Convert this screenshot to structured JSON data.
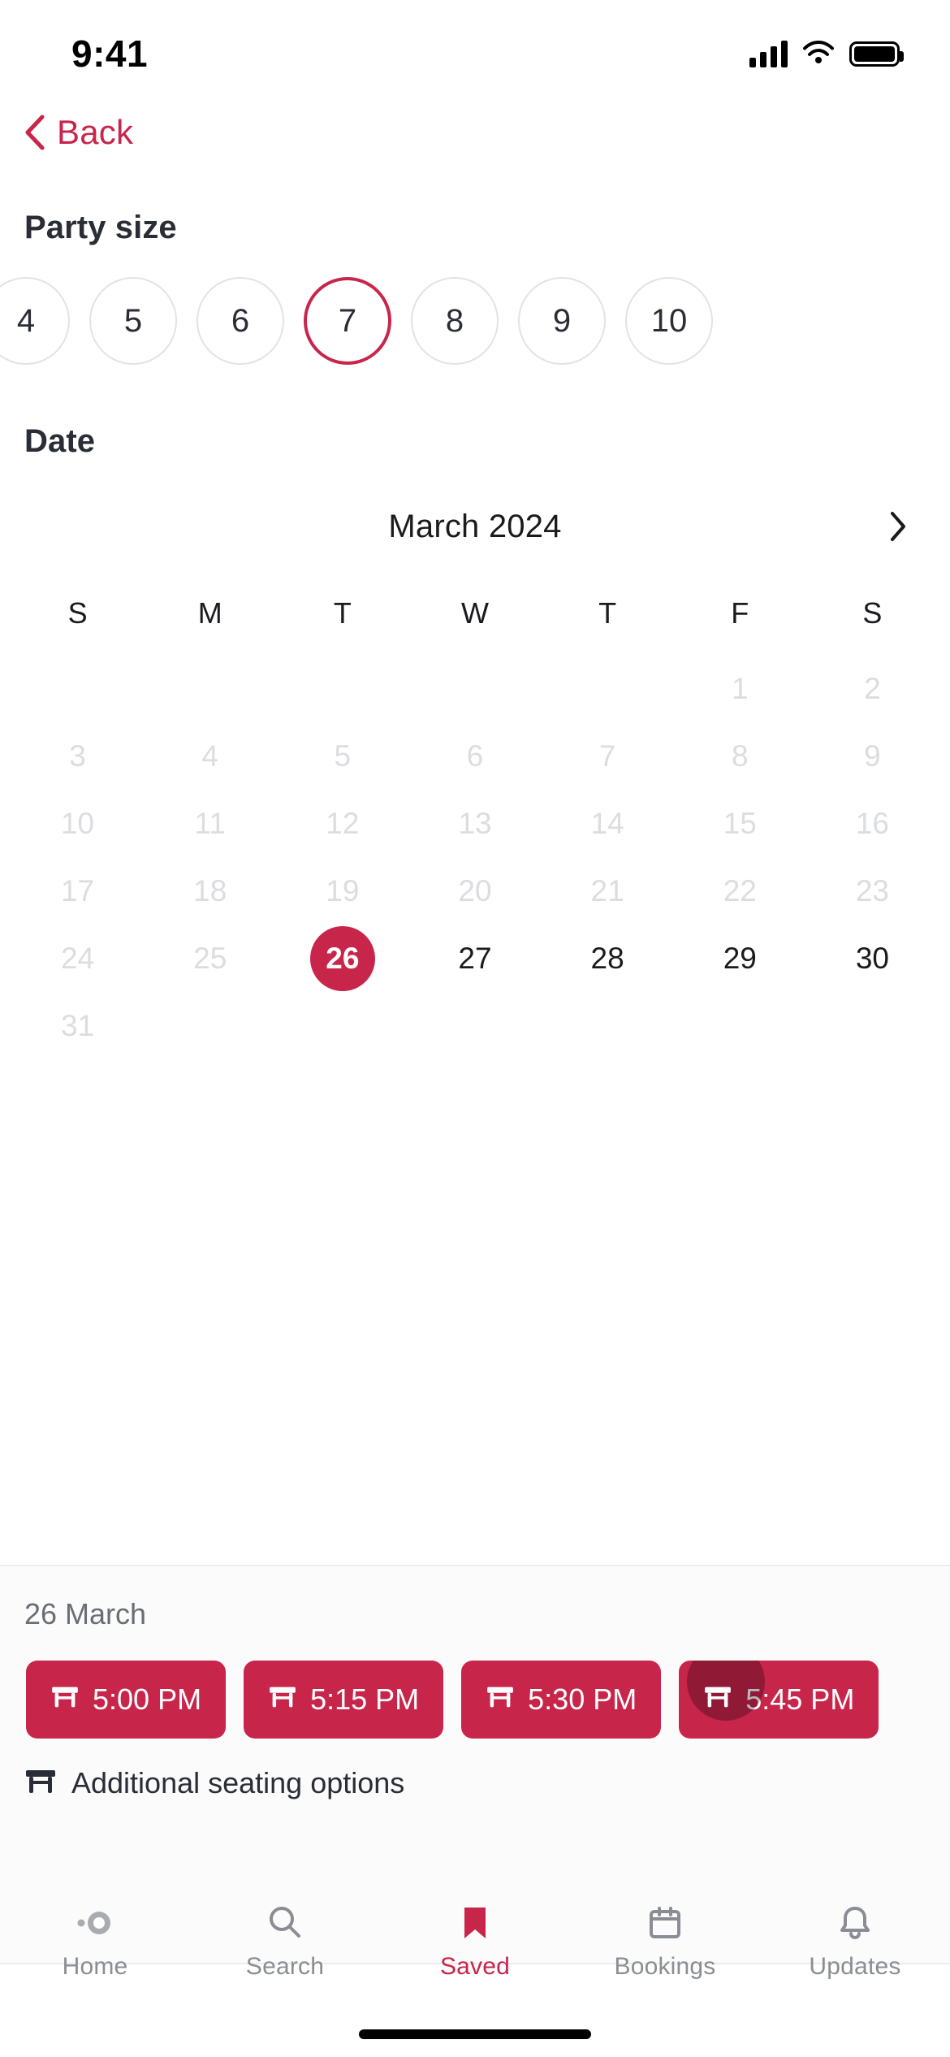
{
  "status_bar": {
    "time": "9:41",
    "signal_icon": "cellular-signal-icon",
    "wifi_icon": "wifi-icon",
    "battery_icon": "battery-full-icon"
  },
  "nav": {
    "back_label": "Back",
    "back_icon": "chevron-left-icon"
  },
  "party_size": {
    "heading": "Party size",
    "options": [
      "4",
      "5",
      "6",
      "7",
      "8",
      "9",
      "10"
    ],
    "selected": "7"
  },
  "date_section": {
    "heading": "Date",
    "month_label": "March 2024",
    "next_month_icon": "chevron-right-icon",
    "weekday_labels": [
      "S",
      "M",
      "T",
      "W",
      "T",
      "F",
      "S"
    ],
    "weeks": [
      [
        {
          "label": "",
          "state": "empty"
        },
        {
          "label": "",
          "state": "empty"
        },
        {
          "label": "",
          "state": "empty"
        },
        {
          "label": "",
          "state": "empty"
        },
        {
          "label": "",
          "state": "empty"
        },
        {
          "label": "1",
          "state": "disabled"
        },
        {
          "label": "2",
          "state": "disabled"
        }
      ],
      [
        {
          "label": "3",
          "state": "disabled"
        },
        {
          "label": "4",
          "state": "disabled"
        },
        {
          "label": "5",
          "state": "disabled"
        },
        {
          "label": "6",
          "state": "disabled"
        },
        {
          "label": "7",
          "state": "disabled"
        },
        {
          "label": "8",
          "state": "disabled"
        },
        {
          "label": "9",
          "state": "disabled"
        }
      ],
      [
        {
          "label": "10",
          "state": "disabled"
        },
        {
          "label": "11",
          "state": "disabled"
        },
        {
          "label": "12",
          "state": "disabled"
        },
        {
          "label": "13",
          "state": "disabled"
        },
        {
          "label": "14",
          "state": "disabled"
        },
        {
          "label": "15",
          "state": "disabled"
        },
        {
          "label": "16",
          "state": "disabled"
        }
      ],
      [
        {
          "label": "17",
          "state": "disabled"
        },
        {
          "label": "18",
          "state": "disabled"
        },
        {
          "label": "19",
          "state": "disabled"
        },
        {
          "label": "20",
          "state": "disabled"
        },
        {
          "label": "21",
          "state": "disabled"
        },
        {
          "label": "22",
          "state": "disabled"
        },
        {
          "label": "23",
          "state": "disabled"
        }
      ],
      [
        {
          "label": "24",
          "state": "disabled"
        },
        {
          "label": "25",
          "state": "disabled"
        },
        {
          "label": "26",
          "state": "selected"
        },
        {
          "label": "27",
          "state": "enabled"
        },
        {
          "label": "28",
          "state": "enabled"
        },
        {
          "label": "29",
          "state": "enabled"
        },
        {
          "label": "30",
          "state": "enabled"
        }
      ],
      [
        {
          "label": "31",
          "state": "disabled"
        },
        {
          "label": "",
          "state": "empty"
        },
        {
          "label": "",
          "state": "empty"
        },
        {
          "label": "",
          "state": "empty"
        },
        {
          "label": "",
          "state": "empty"
        },
        {
          "label": "",
          "state": "empty"
        },
        {
          "label": "",
          "state": "empty"
        }
      ]
    ]
  },
  "slots_panel": {
    "date_label": "26 March",
    "slot_icon": "table-seating-icon",
    "slots": [
      {
        "time": "5:00 PM",
        "pressed": false
      },
      {
        "time": "5:15 PM",
        "pressed": false
      },
      {
        "time": "5:30 PM",
        "pressed": false
      },
      {
        "time": "5:45 PM",
        "pressed": true
      }
    ],
    "additional_label": "Additional seating options",
    "additional_icon": "table-seating-icon"
  },
  "tab_bar": {
    "items": [
      {
        "label": "Home",
        "icon": "home-icon",
        "active": false
      },
      {
        "label": "Search",
        "icon": "search-icon",
        "active": false
      },
      {
        "label": "Saved",
        "icon": "bookmark-icon",
        "active": true
      },
      {
        "label": "Bookings",
        "icon": "calendar-icon",
        "active": false
      },
      {
        "label": "Updates",
        "icon": "bell-icon",
        "active": false
      }
    ]
  },
  "colors": {
    "accent": "#C8254B",
    "text_primary": "#2b2d36",
    "text_muted": "#8b8d94",
    "disabled": "#dcdde0"
  }
}
